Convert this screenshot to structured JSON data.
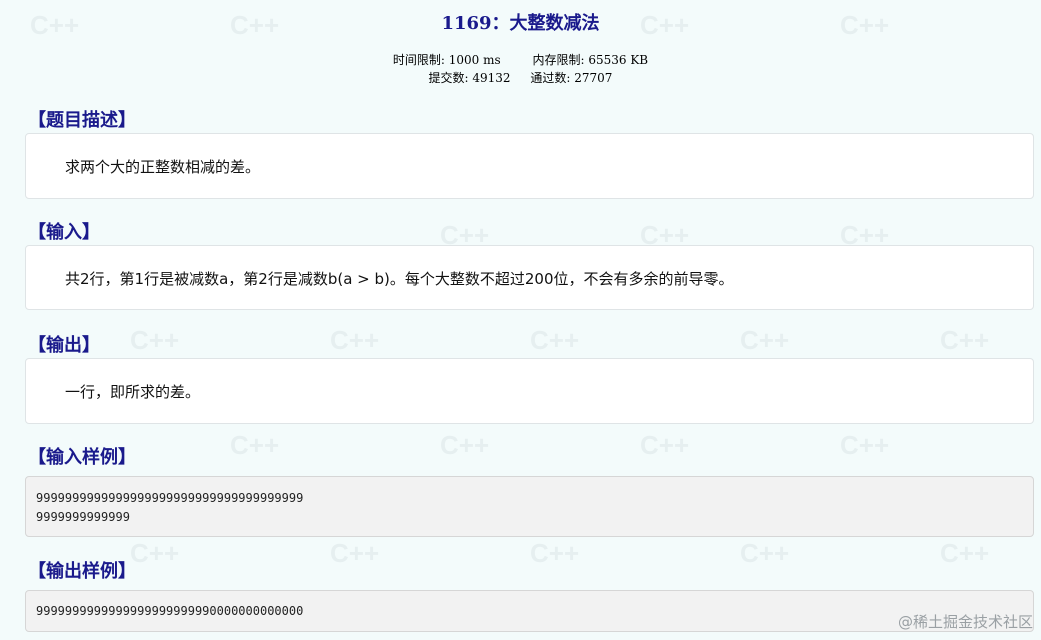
{
  "problem": {
    "title": "1169：大整数减法",
    "time_limit": "时间限制: 1000 ms",
    "memory_limit": "内存限制: 65536 KB",
    "submissions": "提交数: 49132",
    "accepted": "通过数: 27707"
  },
  "sections": {
    "description": {
      "title": "【题目描述】",
      "text": "求两个大的正整数相减的差。"
    },
    "input": {
      "title": "【输入】",
      "text": "共2行，第1行是被减数a，第2行是减数b(a > b)。每个大整数不超过200位，不会有多余的前导零。"
    },
    "output": {
      "title": "【输出】",
      "text": "一行，即所求的差。"
    },
    "sample_input": {
      "title": "【输入样例】",
      "lines": [
        "9999999999999999999999999999999999999",
        "9999999999999"
      ]
    },
    "sample_output": {
      "title": "【输出样例】",
      "lines": [
        "9999999999999999999999990000000000000"
      ]
    }
  },
  "watermark_text": "C++",
  "credit": "@稀土掘金技术社区"
}
